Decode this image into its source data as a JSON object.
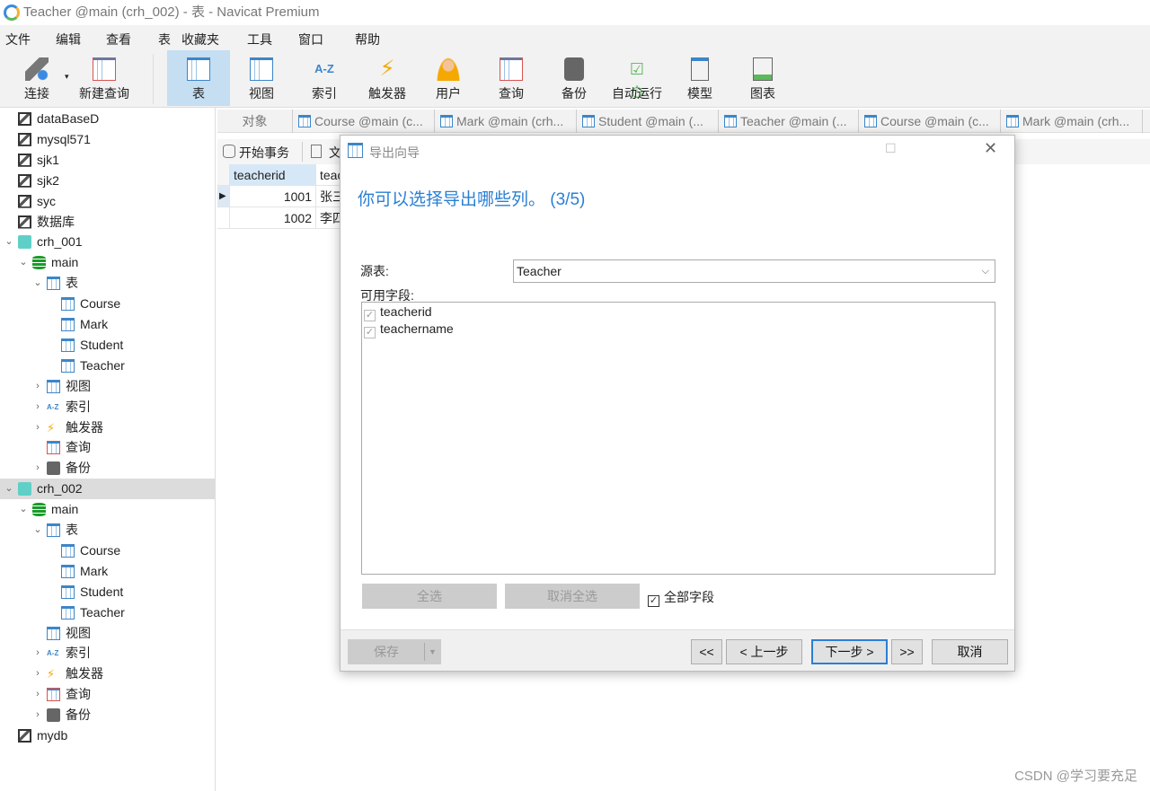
{
  "window": {
    "title": "Teacher @main (crh_002) - 表 - Navicat Premium"
  },
  "menu": [
    "文件",
    "编辑",
    "查看",
    "表",
    "收藏夹",
    "工具",
    "窗口",
    "帮助"
  ],
  "toolbar": [
    "连接",
    "新建查询",
    "表",
    "视图",
    "索引",
    "触发器",
    "用户",
    "查询",
    "备份",
    "自动运行",
    "模型",
    "图表"
  ],
  "tree": [
    {
      "label": "dataBaseD",
      "level": 0,
      "icon": "mysql-connection",
      "exp": ""
    },
    {
      "label": "mysql571",
      "level": 0,
      "icon": "mysql-connection",
      "exp": ""
    },
    {
      "label": "sjk1",
      "level": 0,
      "icon": "mysql-connection",
      "exp": ""
    },
    {
      "label": "sjk2",
      "level": 0,
      "icon": "mysql-connection",
      "exp": ""
    },
    {
      "label": "syc",
      "level": 0,
      "icon": "mysql-connection",
      "exp": ""
    },
    {
      "label": "数据库",
      "level": 0,
      "icon": "mysql-connection",
      "exp": ""
    },
    {
      "label": "crh_001",
      "level": 0,
      "icon": "sqlite-connection",
      "exp": "v"
    },
    {
      "label": "main",
      "level": 1,
      "icon": "database",
      "exp": "v"
    },
    {
      "label": "表",
      "level": 2,
      "icon": "table",
      "exp": "v"
    },
    {
      "label": "Course",
      "level": 3,
      "icon": "table",
      "exp": ""
    },
    {
      "label": "Mark",
      "level": 3,
      "icon": "table",
      "exp": ""
    },
    {
      "label": "Student",
      "level": 3,
      "icon": "table",
      "exp": ""
    },
    {
      "label": "Teacher",
      "level": 3,
      "icon": "table",
      "exp": ""
    },
    {
      "label": "视图",
      "level": 2,
      "icon": "view",
      "exp": ">"
    },
    {
      "label": "索引",
      "level": 2,
      "icon": "index",
      "exp": ">"
    },
    {
      "label": "触发器",
      "level": 2,
      "icon": "trigger",
      "exp": ">"
    },
    {
      "label": "查询",
      "level": 2,
      "icon": "query",
      "exp": ""
    },
    {
      "label": "备份",
      "level": 2,
      "icon": "backup",
      "exp": ">"
    },
    {
      "label": "crh_002",
      "level": 0,
      "icon": "sqlite-connection",
      "exp": "v",
      "selected": true
    },
    {
      "label": "main",
      "level": 1,
      "icon": "database",
      "exp": "v"
    },
    {
      "label": "表",
      "level": 2,
      "icon": "table",
      "exp": "v"
    },
    {
      "label": "Course",
      "level": 3,
      "icon": "table",
      "exp": ""
    },
    {
      "label": "Mark",
      "level": 3,
      "icon": "table",
      "exp": ""
    },
    {
      "label": "Student",
      "level": 3,
      "icon": "table",
      "exp": ""
    },
    {
      "label": "Teacher",
      "level": 3,
      "icon": "table",
      "exp": ""
    },
    {
      "label": "视图",
      "level": 2,
      "icon": "view",
      "exp": ""
    },
    {
      "label": "索引",
      "level": 2,
      "icon": "index",
      "exp": ">"
    },
    {
      "label": "触发器",
      "level": 2,
      "icon": "trigger",
      "exp": ">"
    },
    {
      "label": "查询",
      "level": 2,
      "icon": "query",
      "exp": ">"
    },
    {
      "label": "备份",
      "level": 2,
      "icon": "backup",
      "exp": ">"
    },
    {
      "label": "mydb",
      "level": 0,
      "icon": "mysql-connection",
      "exp": ""
    }
  ],
  "tabs": {
    "objects": "对象",
    "items": [
      "Course @main (c...",
      "Mark @main (crh...",
      "Student @main (...",
      "Teacher @main (...",
      "Course @main (c...",
      "Mark @main (crh..."
    ]
  },
  "subtoolbar": {
    "begin_transaction": "开始事务",
    "text": "文"
  },
  "grid": {
    "headers": [
      "teacherid",
      "teac"
    ],
    "rows": [
      [
        "1001",
        "张三"
      ],
      [
        "1002",
        "李四"
      ]
    ]
  },
  "dialog": {
    "title": "导出向导",
    "heading": "你可以选择导出哪些列。 (3/5)",
    "source_label": "源表:",
    "source_value": "Teacher",
    "fields_label": "可用字段:",
    "fields": [
      "teacherid",
      "teachername"
    ],
    "select_all": "全选",
    "deselect_all": "取消全选",
    "all_fields": "全部字段",
    "save": "保存",
    "first": "<<",
    "back": "< 上一步",
    "next": "下一步 >",
    "last": ">>",
    "cancel": "取消"
  },
  "watermark": "CSDN @学习要充足"
}
